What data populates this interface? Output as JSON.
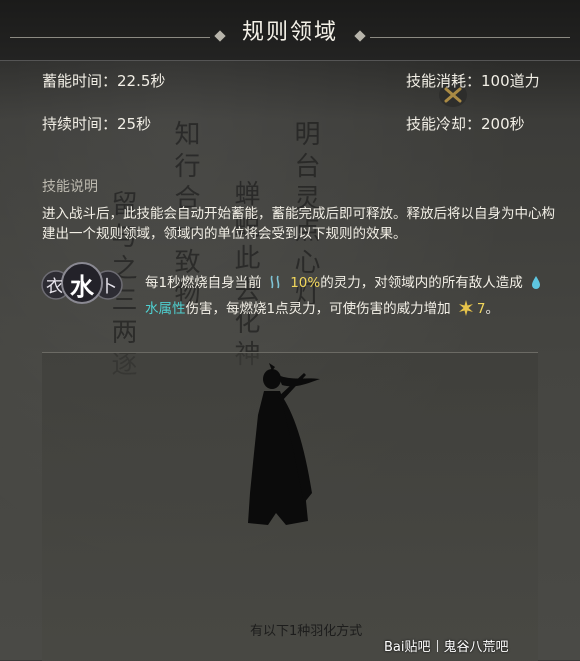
{
  "header": {
    "title": "规则领域"
  },
  "stats": {
    "charge_time": "蓄能时间：22.5秒",
    "skill_cost": "技能消耗：100道力",
    "duration": "持续时间：25秒",
    "cooldown": "技能冷却：200秒"
  },
  "background_calligraphy": {
    "col1": "留与之三两逐",
    "col2": "知行合一致物",
    "col3": "蝉蜕此去化神",
    "col4": "明台灵点心灯"
  },
  "description": {
    "label": "技能说明",
    "text": "进入战斗后，此技能会自动开始蓄能，蓄能完成后即可释放。释放后将以自身为中心构建出一个规则领域，领域内的单位将会受到以下规则的效果。"
  },
  "rule": {
    "icon_glyph_main": "水",
    "icon_glyph_left": "衣",
    "icon_glyph_right": "卜",
    "text_a": "每1秒燃烧自身当前",
    "percent": "10%",
    "text_b": "的灵力，对领域内的所有敌人造成",
    "element": "水属性",
    "text_c": "伤害，每燃烧1点灵力，可使伤害的威力增加",
    "amount": "7",
    "text_d": "。"
  },
  "footer": {
    "note": "有以下1种羽化方式",
    "watermark_brand": "Bai贴吧",
    "watermark_forum": "鬼谷八荒吧"
  },
  "colors": {
    "highlight_number": "#f2d75b",
    "highlight_water": "#4fd0d0"
  }
}
